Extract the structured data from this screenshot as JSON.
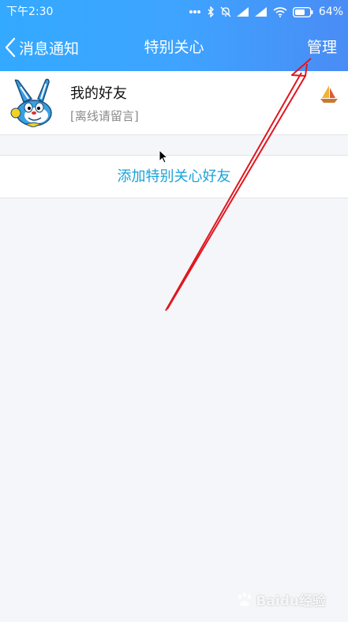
{
  "status_bar": {
    "time": "下午2:30",
    "battery": "64%",
    "icons": [
      "more-dots-icon",
      "bluetooth-icon",
      "bell-muted-icon",
      "signal-icon",
      "signal-icon",
      "wifi-icon",
      "battery-icon"
    ]
  },
  "nav": {
    "back_label": "消息通知",
    "title": "特别关心",
    "manage_label": "管理"
  },
  "friend": {
    "name": "我的好友",
    "status": "[离线请留言]"
  },
  "add_friend_label": "添加特别关心好友",
  "watermark": "Baidu经验",
  "colors": {
    "header": "#3ea4ff",
    "link": "#1aa3d8",
    "annotation": "#e0161e"
  }
}
